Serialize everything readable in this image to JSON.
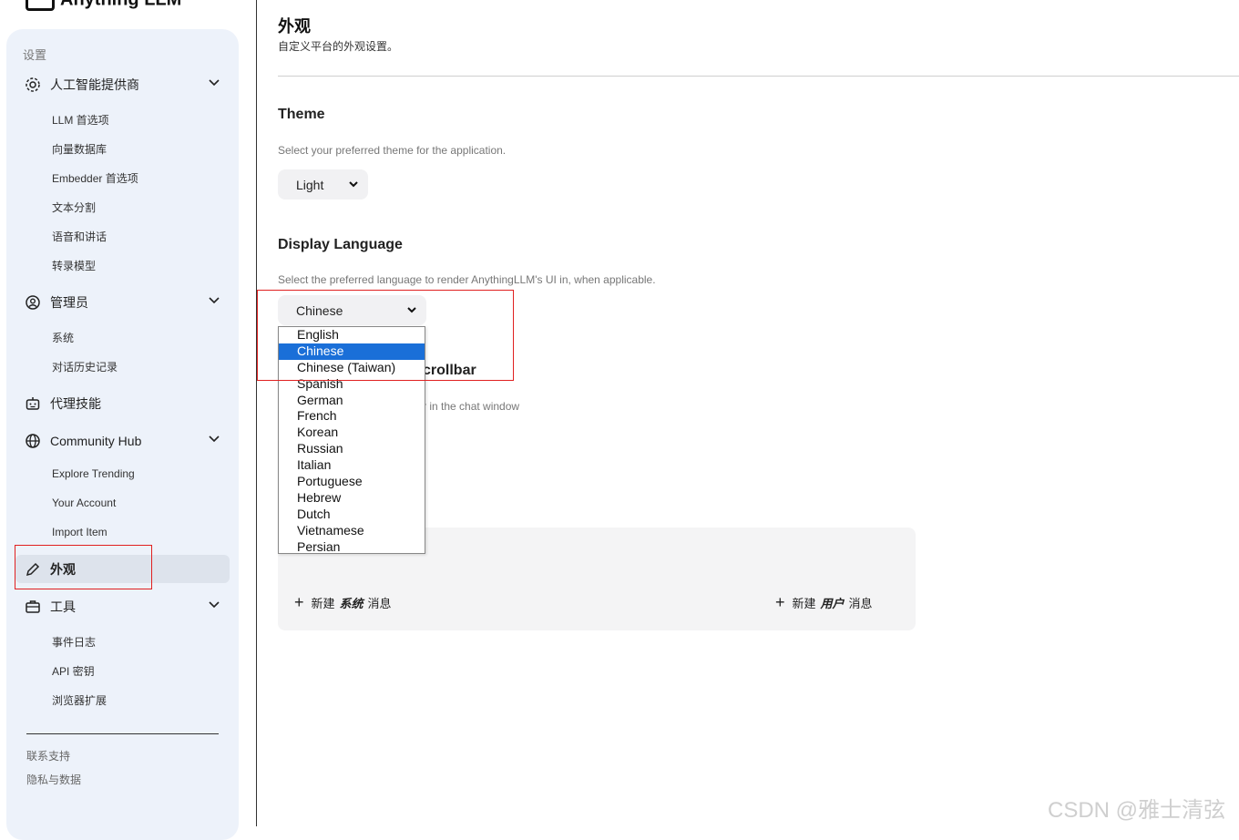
{
  "app": {
    "logo_text": "Anything LLM"
  },
  "sidebar": {
    "section_label": "设置",
    "groups": [
      {
        "label": "人工智能提供商",
        "icon": "gear-icon",
        "items": [
          "LLM 首选项",
          "向量数据库",
          "Embedder 首选项",
          "文本分割",
          "语音和讲话",
          "转录模型"
        ]
      },
      {
        "label": "管理员",
        "icon": "user-gear-icon",
        "items": [
          "系统",
          "对话历史记录"
        ]
      },
      {
        "label": "代理技能",
        "icon": "robot-icon",
        "items": []
      },
      {
        "label": "Community Hub",
        "icon": "globe-icon",
        "items": [
          "Explore Trending",
          "Your Account",
          "Import Item"
        ]
      },
      {
        "label": "外观",
        "icon": "pencil-icon",
        "items": [],
        "active": true
      },
      {
        "label": "工具",
        "icon": "briefcase-icon",
        "items": [
          "事件日志",
          "API 密钥",
          "浏览器扩展"
        ]
      }
    ],
    "footer": [
      "联系支持",
      "隐私与数据"
    ]
  },
  "main": {
    "title": "外观",
    "subtitle": "自定义平台的外观设置。",
    "theme": {
      "heading": "Theme",
      "description": "Select your preferred theme for the application.",
      "value": "Light"
    },
    "language": {
      "heading": "Display Language",
      "description": "Select the preferred language to render AnythingLLM's UI in, when applicable.",
      "value": "Chinese",
      "options": [
        "English",
        "Chinese",
        "Chinese (Taiwan)",
        "Spanish",
        "German",
        "French",
        "Korean",
        "Russian",
        "Italian",
        "Portuguese",
        "Hebrew",
        "Dutch",
        "Vietnamese",
        "Persian"
      ]
    },
    "scrollbar": {
      "heading_visible": "crollbar",
      "description_visible": "r in the chat window"
    },
    "messages": {
      "new_system_prefix": "新建",
      "new_system_strong": "系统",
      "new_system_suffix": "消息",
      "new_user_prefix": "新建",
      "new_user_strong": "用户",
      "new_user_suffix": "消息"
    }
  },
  "watermark": "CSDN @雅士清弦",
  "colors": {
    "sidebar_bg": "#edf2fa",
    "selected_option": "#1a6fd8",
    "annotation_box": "#e02020"
  }
}
